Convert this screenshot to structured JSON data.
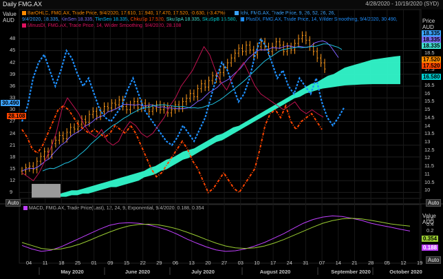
{
  "window": {
    "title": "Daily FMG.AX",
    "date_range": "4/28/2020 - 10/19/2020 (SYD)"
  },
  "axes": {
    "left_label_top": "Value",
    "left_label_unit": "AUD",
    "right_label_top": "Price",
    "right_label_unit": "AUD",
    "macd_right_top": "Value",
    "macd_right_unit": "AUD",
    "auto_label": "Auto"
  },
  "legend": {
    "bar": {
      "text": "BarOHLC, FMG.AX, Trade Price, 9/4/2020, 17.610, 17.940, 17.470, 17.520, -0.630, (-3.47%)",
      "color": "#ff8c00"
    },
    "ichi": {
      "text": "Ichi, FMG.AX, Trade Price,  9, 26, 52, 26, 26,",
      "color": "#3ba4ff"
    },
    "ichi_values": [
      {
        "text": "9/4/2020, 18.335,",
        "color": "#3ba4ff"
      },
      {
        "text": "KinSen 18.335,",
        "color": "#7b68ee"
      },
      {
        "text": "TknSen 18.335,",
        "color": "#00bfff"
      },
      {
        "text": "ChkuSp 17.520,",
        "color": "#ff4500"
      },
      {
        "text": "SkuSpA 18.335,",
        "color": "#40e0d0"
      },
      {
        "text": "SkuSpB 16.580,",
        "color": "#00ced1"
      }
    ],
    "plusdi": {
      "text": "PlusDI, FMG.AX, Trade Price,  14, Wilder Smoothing, 9/4/2020, 30.490,",
      "color": "#1e90ff"
    },
    "minusdi": {
      "text": "MinusDI, FMG.AX, Trade Price,  14, Wilder Smoothing, 9/4/2020, 28.108",
      "color": "#e0115f"
    },
    "macd": {
      "text": "MACD, FMG.AX, Trade Price(Last),  12, 24, 9, Exponential, 9/4/2020, 0.188, 0.354",
      "color": "#c040ff"
    }
  },
  "value_boxes": {
    "left_plusdi": "30.490",
    "left_minusdi": "28.108",
    "right_ichi_a": "18.335",
    "right_ichi_b": "18.335",
    "right_ichi_c": "18.335",
    "right_price": "17.520",
    "right_chikou": "17.520",
    "right_spanb": "16.580",
    "macd_signal": "0.354",
    "macd_value": "0.188"
  },
  "chart_data": [
    {
      "type": "line",
      "name": "price-panel",
      "title": "Daily FMG.AX",
      "y_left_ticks": [
        "48",
        "45",
        "42",
        "39",
        "36",
        "33",
        "30",
        "27",
        "24",
        "21",
        "18",
        "15",
        "12",
        "9"
      ],
      "y_left_range": [
        7.5,
        50.5
      ],
      "y_right_ticks": [
        "19",
        "18.5",
        "18",
        "17.5",
        "17",
        "16.5",
        "16",
        "15.5",
        "15",
        "14.5",
        "14",
        "13.5",
        "13",
        "12.5",
        "12",
        "11.5",
        "11",
        "10.5",
        "10"
      ],
      "y_right_range": [
        9.5,
        20.0
      ],
      "x_ticks": [
        "04",
        "11",
        "18",
        "25",
        "01",
        "09",
        "15",
        "22",
        "29",
        "06",
        "13",
        "20",
        "27",
        "03",
        "10",
        "17",
        "24",
        "31",
        "07",
        "14",
        "21",
        "28",
        "05",
        "12",
        "19"
      ],
      "x_months": [
        "May 2020",
        "June 2020",
        "July 2020",
        "August 2020",
        "September 2020",
        "October 2020"
      ],
      "price_close": [
        11.2,
        11.4,
        11.5,
        11.3,
        11.8,
        12.1,
        12.4,
        12.2,
        12.9,
        13.1,
        13.4,
        13.2,
        13.6,
        13.9,
        13.8,
        14.1,
        14.4,
        14.2,
        14.7,
        14.9,
        14.6,
        14.9,
        15.2,
        15.1,
        15.4,
        15.3,
        15.6,
        15.2,
        15.0,
        15.3,
        15.5,
        15.1,
        15.4,
        15.2,
        14.9,
        15.1,
        15.3,
        15.0,
        15.2,
        14.8,
        15.0,
        15.3,
        15.1,
        15.5,
        15.7,
        16.0,
        15.8,
        16.3,
        16.6,
        16.4,
        16.8,
        17.1,
        16.9,
        17.3,
        17.6,
        17.9,
        18.2,
        18.5,
        18.8,
        18.6,
        19.0,
        18.7,
        18.4,
        18.9,
        19.2,
        18.9,
        18.6,
        18.9,
        19.2,
        19.0,
        18.6,
        18.9,
        18.7,
        19.1,
        19.4,
        19.6,
        19.3,
        18.9,
        18.6,
        18.2,
        17.9,
        17.52
      ],
      "ichimoku_cloud_upper": [
        9.8,
        9.9,
        10.0,
        10.0,
        10.1,
        10.2,
        10.3,
        10.4,
        10.5,
        10.6,
        10.7,
        10.8,
        10.9,
        11.0,
        11.1,
        11.2,
        11.4,
        11.5,
        11.7,
        11.9,
        12.0,
        12.2,
        12.4,
        12.5,
        12.6,
        12.8,
        13.0,
        13.2,
        13.4,
        13.5,
        13.7,
        13.9,
        14.0,
        14.2,
        14.4,
        14.6,
        14.8,
        15.0,
        15.2,
        15.4,
        15.6,
        15.8,
        16.0,
        16.2,
        16.4,
        16.6,
        16.7,
        16.9,
        17.1,
        17.2,
        17.4,
        17.6,
        17.7,
        17.8,
        17.9,
        18.0,
        18.1,
        18.15,
        18.2,
        18.25,
        18.3,
        18.335
      ],
      "ichimoku_cloud_lower": [
        9.6,
        9.6,
        9.7,
        9.7,
        9.8,
        9.8,
        9.9,
        10.0,
        10.1,
        10.2,
        10.2,
        10.3,
        10.4,
        10.5,
        10.6,
        10.8,
        10.9,
        11.0,
        11.2,
        11.3,
        11.5,
        11.7,
        11.9,
        12.0,
        12.2,
        12.4,
        12.6,
        12.8,
        13.0,
        13.1,
        13.3,
        13.5,
        13.7,
        13.9,
        14.1,
        14.3,
        14.5,
        14.7,
        14.9,
        15.1,
        15.3,
        15.5,
        15.7,
        15.8,
        16.0,
        16.1,
        16.2,
        16.3,
        16.35,
        16.4,
        16.45,
        16.5,
        16.52,
        16.54,
        16.56,
        16.57,
        16.58,
        16.58,
        16.58,
        16.58,
        16.58,
        16.58
      ],
      "plus_di": [
        27,
        31,
        38,
        42,
        44,
        40,
        36,
        40,
        45,
        43,
        39,
        36,
        38,
        34,
        30,
        28,
        27,
        29,
        31,
        35,
        38,
        34,
        30,
        28,
        26,
        24,
        22,
        21,
        23,
        26,
        24,
        22,
        25,
        28,
        33,
        38,
        42,
        40,
        36,
        32,
        34,
        38,
        44,
        48,
        46,
        42,
        38,
        40,
        36,
        34,
        38,
        36,
        34,
        38,
        32,
        28,
        26,
        28,
        30.49
      ],
      "minus_di": [
        14,
        13,
        12,
        14,
        17,
        20,
        24,
        30,
        33,
        31,
        29,
        26,
        24,
        23,
        25,
        22,
        21,
        22,
        25,
        27,
        26,
        24,
        23,
        24,
        26,
        28,
        31,
        33,
        36,
        38,
        40,
        43,
        46,
        44,
        40,
        37,
        35,
        38,
        40,
        42,
        39,
        36,
        34,
        33,
        32,
        31,
        30,
        31,
        32,
        30,
        29,
        30,
        29,
        28.1
      ],
      "chikou_span": [
        25,
        23,
        20,
        19,
        21,
        24,
        27,
        30,
        31,
        30,
        28,
        26,
        25,
        24,
        25,
        24,
        23,
        24,
        26,
        25,
        24,
        26,
        24,
        21,
        18,
        15,
        13,
        14,
        16,
        18,
        20,
        22,
        20,
        17,
        15,
        12,
        9,
        10,
        12,
        14,
        12,
        10,
        9,
        11,
        13,
        15,
        20,
        26,
        29,
        30,
        28,
        31,
        27,
        25,
        27,
        28,
        29,
        27,
        25
      ]
    },
    {
      "type": "line",
      "name": "macd-panel",
      "title": "MACD",
      "y_ticks": [
        "0.6",
        "0.4",
        "0.2"
      ],
      "y_range": [
        -0.9,
        0.85
      ],
      "series": [
        {
          "name": "MACD",
          "values": [
            -0.3,
            -0.42,
            -0.5,
            -0.46,
            -0.35,
            -0.2,
            -0.05,
            0.1,
            0.25,
            0.38,
            0.45,
            0.47,
            0.45,
            0.4,
            0.32,
            0.22,
            0.08,
            -0.08,
            -0.22,
            -0.35,
            -0.45,
            -0.5,
            -0.48,
            -0.42,
            -0.32,
            -0.2,
            -0.05,
            0.1,
            0.28,
            0.45,
            0.58,
            0.66,
            0.7,
            0.68,
            0.62,
            0.55,
            0.45,
            0.38,
            0.32,
            0.25,
            0.188
          ]
        },
        {
          "name": "Signal",
          "values": [
            -0.2,
            -0.3,
            -0.4,
            -0.44,
            -0.42,
            -0.35,
            -0.25,
            -0.12,
            0.02,
            0.15,
            0.27,
            0.36,
            0.41,
            0.42,
            0.4,
            0.34,
            0.26,
            0.15,
            0.03,
            -0.1,
            -0.22,
            -0.32,
            -0.38,
            -0.4,
            -0.38,
            -0.32,
            -0.22,
            -0.1,
            0.04,
            0.18,
            0.32,
            0.45,
            0.54,
            0.6,
            0.62,
            0.6,
            0.55,
            0.49,
            0.43,
            0.39,
            0.354
          ]
        }
      ]
    }
  ]
}
